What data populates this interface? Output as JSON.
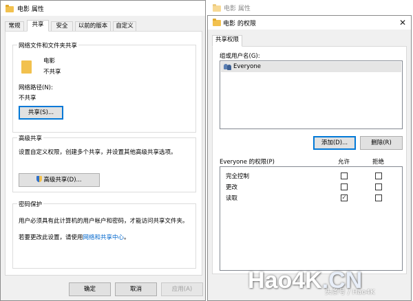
{
  "left_window": {
    "title": "电影 属性",
    "tabs": [
      "常规",
      "共享",
      "安全",
      "以前的版本",
      "自定义"
    ],
    "active_tab": 1,
    "network_sharing": {
      "group_label": "网络文件和文件夹共享",
      "item_name": "电影",
      "item_status": "不共享",
      "network_path_label": "网络路径(N):",
      "network_path_value": "不共享",
      "share_button": "共享(S)..."
    },
    "advanced_sharing": {
      "group_label": "高级共享",
      "description": "设置自定义权限，创建多个共享，并设置其他高级共享选项。",
      "button": "高级共享(D)..."
    },
    "password_protection": {
      "group_label": "密码保护",
      "description": "用户必须具有此计算机的用户帐户和密码，才能访问共享文件夹。",
      "change_prefix": "若要更改此设置，请使用",
      "change_link": "网络和共享中心",
      "change_suffix": "。"
    },
    "footer": {
      "ok": "确定",
      "cancel": "取消",
      "apply": "应用(A)"
    }
  },
  "right_window": {
    "background_title": "电影 属性",
    "title": "电影 的权限",
    "close_symbol": "✕",
    "tab": "共享权限",
    "users_label": "组或用户名(G):",
    "users": [
      "Everyone"
    ],
    "add_button": "添加(D)...",
    "remove_button": "删除(R)",
    "permissions_label": "Everyone 的权限(P)",
    "allow_header": "允许",
    "deny_header": "拒绝",
    "permissions": [
      {
        "name": "完全控制",
        "allow": false,
        "deny": false
      },
      {
        "name": "更改",
        "allow": false,
        "deny": false
      },
      {
        "name": "读取",
        "allow": true,
        "deny": false
      }
    ],
    "check_mark": "✓"
  },
  "watermark": {
    "brand": "Hao4K",
    "brand_tld": ".CN",
    "source": "头条号 / Hao4K"
  },
  "colors": {
    "link": "#0066cc",
    "focus": "#0078d7",
    "selection": "#e5e5e5"
  }
}
